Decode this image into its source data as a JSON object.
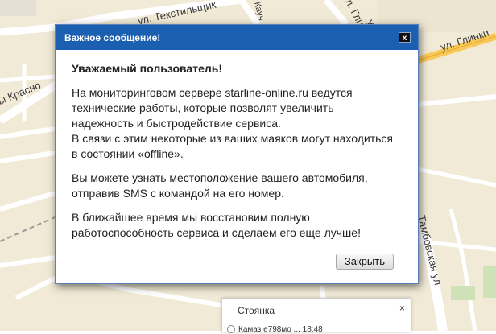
{
  "map": {
    "streets": {
      "s1": "ул. Текстильщик",
      "s2": "Кауч",
      "s3": "ул. Глинки",
      "s4": "ул. Глинки",
      "s5": "ы Красно",
      "s6": "Тамбовская ул.",
      "s7": "ул."
    }
  },
  "dialog": {
    "title": "Важное сообщение!",
    "close_glyph": "x",
    "greeting": "Уважаемый пользователь!",
    "p1": [
      "На мониторинговом сервере starline-online.ru ведутся",
      "технические работы, которые позволят увеличить",
      "надежность и быстродействие сервиса.",
      "В связи с этим некоторые из ваших маяков могут находиться",
      "в состоянии «offline»."
    ],
    "p2": [
      "Вы можете узнать местоположение вашего автомобиля,",
      "отправив SMS с командой на его номер."
    ],
    "p3": [
      "В ближайшее время мы восстановим полную",
      "работоспособность сервиса и сделаем его еще лучше!"
    ],
    "close_button": "Закрыть"
  },
  "parking": {
    "title": "Стоянка",
    "close_glyph": "×",
    "row_text": "Камаз е798мо ... 18:48"
  }
}
